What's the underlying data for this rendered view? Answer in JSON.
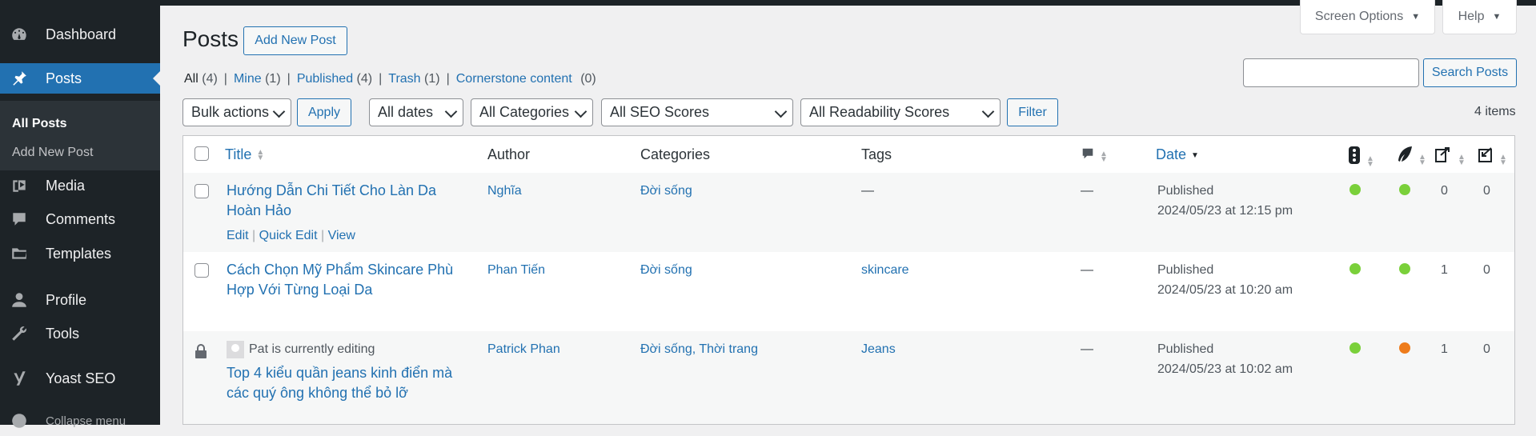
{
  "sidebar": {
    "items": [
      {
        "label": "Dashboard",
        "icon": "dashboard-icon"
      },
      {
        "label": "Posts",
        "icon": "pin-icon"
      },
      {
        "label": "Media",
        "icon": "media-icon"
      },
      {
        "label": "Comments",
        "icon": "comment-icon"
      },
      {
        "label": "Templates",
        "icon": "folder-icon"
      },
      {
        "label": "Profile",
        "icon": "user-icon"
      },
      {
        "label": "Tools",
        "icon": "wrench-icon"
      },
      {
        "label": "Yoast SEO",
        "icon": "yoast-icon"
      },
      {
        "label": "Collapse menu",
        "icon": "collapse-icon"
      }
    ],
    "submenu": [
      "All Posts",
      "Add New Post"
    ]
  },
  "header": {
    "title": "Posts",
    "add_new": "Add New Post",
    "screen_options": "Screen Options",
    "help": "Help"
  },
  "views": [
    {
      "label": "All",
      "count": "(4)"
    },
    {
      "label": "Mine",
      "count": "(1)"
    },
    {
      "label": "Published",
      "count": "(4)"
    },
    {
      "label": "Trash",
      "count": "(1)"
    },
    {
      "label": "Cornerstone content",
      "count": "(0)"
    }
  ],
  "search": {
    "button": "Search Posts",
    "value": ""
  },
  "filters": {
    "bulk": "Bulk actions",
    "apply": "Apply",
    "dates": "All dates",
    "categories": "All Categories",
    "seo": "All SEO Scores",
    "readability": "All Readability Scores",
    "filter": "Filter"
  },
  "items_count": "4 items",
  "table": {
    "headers": {
      "title": "Title",
      "author": "Author",
      "categories": "Categories",
      "tags": "Tags",
      "date": "Date"
    },
    "rows": [
      {
        "title": "Hướng Dẫn Chi Tiết Cho Làn Da Hoàn Hảo",
        "author": "Nghĩa",
        "categories": "Đời sống",
        "tags": "—",
        "comments": "—",
        "status": "Published",
        "date": "2024/05/23 at 12:15 pm",
        "seo_color": "#7ad03a",
        "read_color": "#7ad03a",
        "links_out": "0",
        "links_in": "0",
        "actions": [
          "Edit",
          "Quick Edit",
          "View"
        ]
      },
      {
        "title": "Cách Chọn Mỹ Phẩm Skincare Phù Hợp Với Từng Loại Da",
        "author": "Phan Tiến",
        "categories": "Đời sống",
        "tags": "skincare",
        "comments": "—",
        "status": "Published",
        "date": "2024/05/23 at 10:20 am",
        "seo_color": "#7ad03a",
        "read_color": "#7ad03a",
        "links_out": "1",
        "links_in": "0"
      },
      {
        "locked_text": "Pat is currently editing",
        "title": "Top 4 kiểu quần jeans kinh điển mà các quý ông không thể bỏ lỡ",
        "author": "Patrick Phan",
        "categories": "Đời sống, Thời trang",
        "tags": "Jeans",
        "comments": "—",
        "status": "Published",
        "date": "2024/05/23 at 10:02 am",
        "seo_color": "#7ad03a",
        "read_color": "#ee7c1b",
        "links_out": "1",
        "links_in": "0"
      }
    ]
  }
}
